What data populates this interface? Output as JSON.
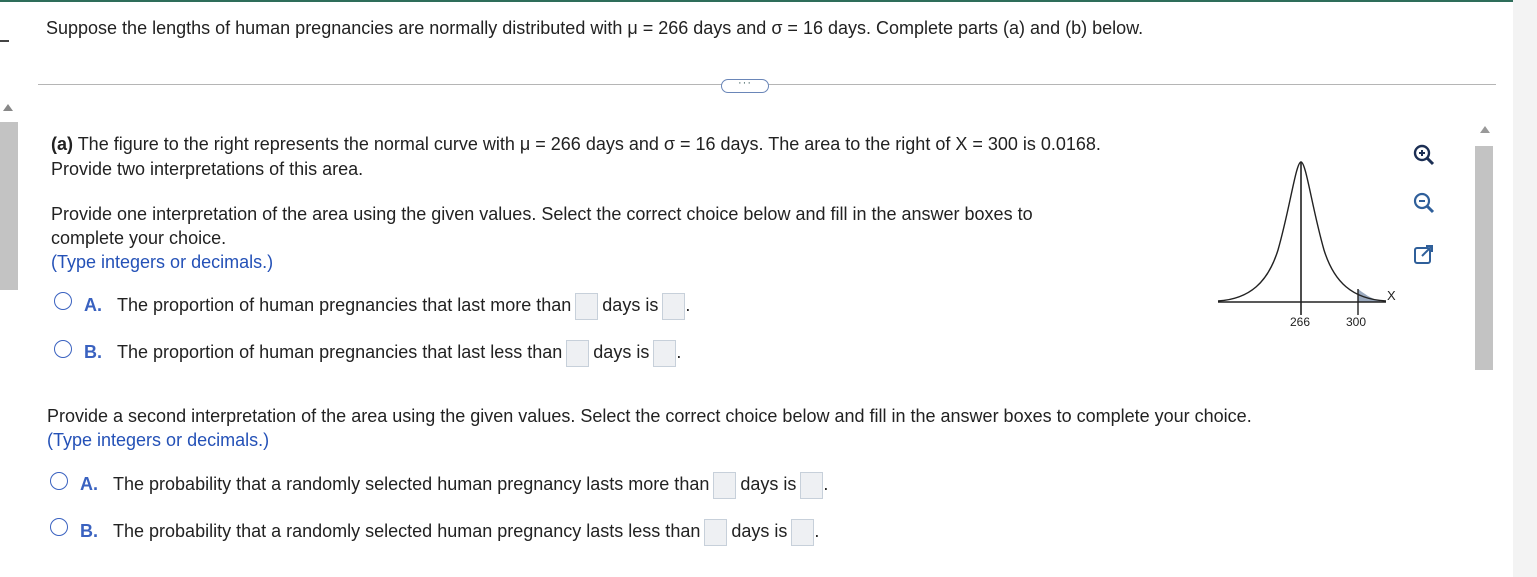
{
  "question": {
    "text": "Suppose the lengths of human pregnancies are normally distributed with μ = 266 days and σ = 16 days. Complete parts (a) and (b) below."
  },
  "more_button": {
    "label": "···"
  },
  "part_a": {
    "label": "(a)",
    "description_line1": "The figure to the right represents the normal curve with μ = 266 days and σ = 16 days. The area to the right of X = 300 is 0.0168.",
    "description_line2": "Provide two interpretations of this area.",
    "first_prompt_line1": "Provide one interpretation of the area using the given values. Select the correct choice below and fill in the answer boxes to",
    "first_prompt_line2": "complete your choice.",
    "first_hint": "(Type integers or decimals.)",
    "first_choices": [
      {
        "letter": "A.",
        "text_before": "The proportion of human pregnancies that last more than",
        "text_middle": "days is",
        "end": "."
      },
      {
        "letter": "B.",
        "text_before": "The proportion of human pregnancies that last less than",
        "text_middle": "days is",
        "end": "."
      }
    ],
    "second_prompt": "Provide a second interpretation of the area using the given values. Select the correct choice below and fill in the answer boxes to complete your choice.",
    "second_hint": "(Type integers or decimals.)",
    "second_choices": [
      {
        "letter": "A.",
        "text_before": "The probability that a randomly selected human pregnancy lasts more than",
        "text_middle": "days is",
        "end": "."
      },
      {
        "letter": "B.",
        "text_before": "The probability that a randomly selected human pregnancy lasts less than",
        "text_middle": "days is",
        "end": "."
      }
    ]
  },
  "figure": {
    "mean_label": "266",
    "x_label": "300",
    "axis_label": "X"
  },
  "colors": {
    "accent": "#2451b7",
    "radio": "#3a62c0",
    "top_rule": "#2e6d5a"
  },
  "icons": [
    "zoom-in-icon",
    "zoom-out-icon",
    "popout-icon"
  ]
}
